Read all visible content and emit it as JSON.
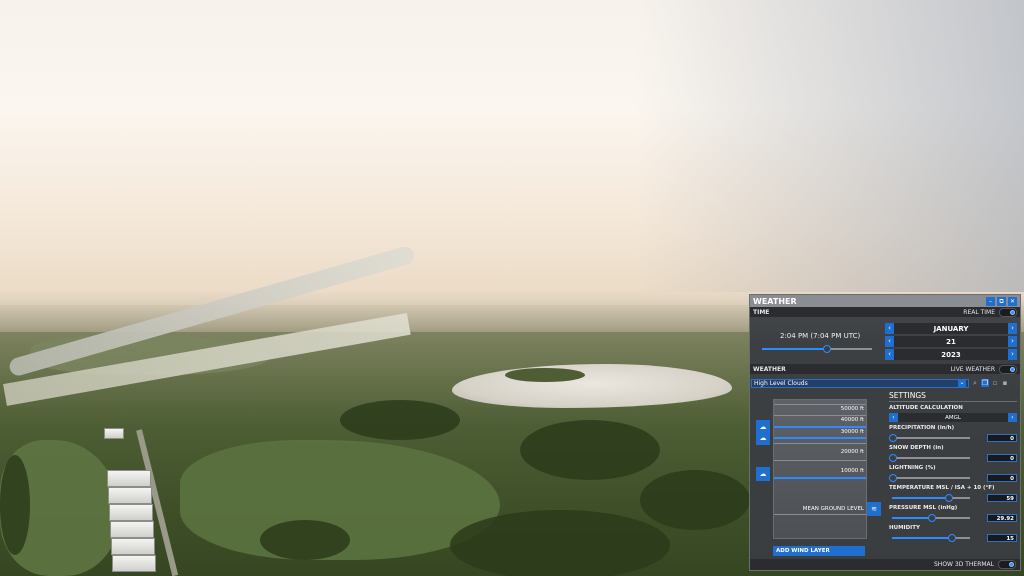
{
  "panel": {
    "title": "WEATHER",
    "window_buttons": [
      "minimize-icon",
      "popout-icon",
      "close-icon"
    ]
  },
  "time": {
    "section_label": "TIME",
    "real_time_label": "REAL TIME",
    "clock": "2:04 PM (7:04 PM UTC)",
    "slider_fraction": 0.58,
    "month": "JANUARY",
    "day": "21",
    "year": "2023"
  },
  "weather": {
    "section_label": "WEATHER",
    "live_weather_label": "LIVE WEATHER",
    "preset": "High Level Clouds",
    "altitudes": [
      "50000 ft",
      "40000 ft",
      "30000 ft",
      "20000 ft",
      "10000 ft"
    ],
    "ground_label": "MEAN GROUND LEVEL",
    "add_wind_label": "ADD WIND LAYER"
  },
  "settings": {
    "title": "SETTINGS",
    "altitude_calc_label": "ALTITUDE CALCULATION",
    "altitude_calc_value": "AMGL",
    "precipitation": {
      "label": "PRECIPITATION (in/h)",
      "value": "0",
      "fraction": 0.0
    },
    "snow": {
      "label": "SNOW DEPTH (in)",
      "value": "0",
      "fraction": 0.0
    },
    "lightning": {
      "label": "LIGHTNING (%)",
      "value": "0",
      "fraction": 0.0
    },
    "temperature": {
      "label": "TEMPERATURE MSL / ISA + 10 (°F)",
      "value": "59",
      "fraction": 0.72
    },
    "pressure": {
      "label": "PRESSURE MSL (inHg)",
      "value": "29.92",
      "fraction": 0.5
    },
    "humidity": {
      "label": "HUMIDITY",
      "value": "15",
      "fraction": 0.75
    }
  },
  "footer": {
    "thermal_label": "SHOW 3D THERMAL"
  },
  "colors": {
    "accent": "#1e6fd0",
    "panel_bg": "#3a3d42",
    "header_bg": "#8a8d92"
  }
}
